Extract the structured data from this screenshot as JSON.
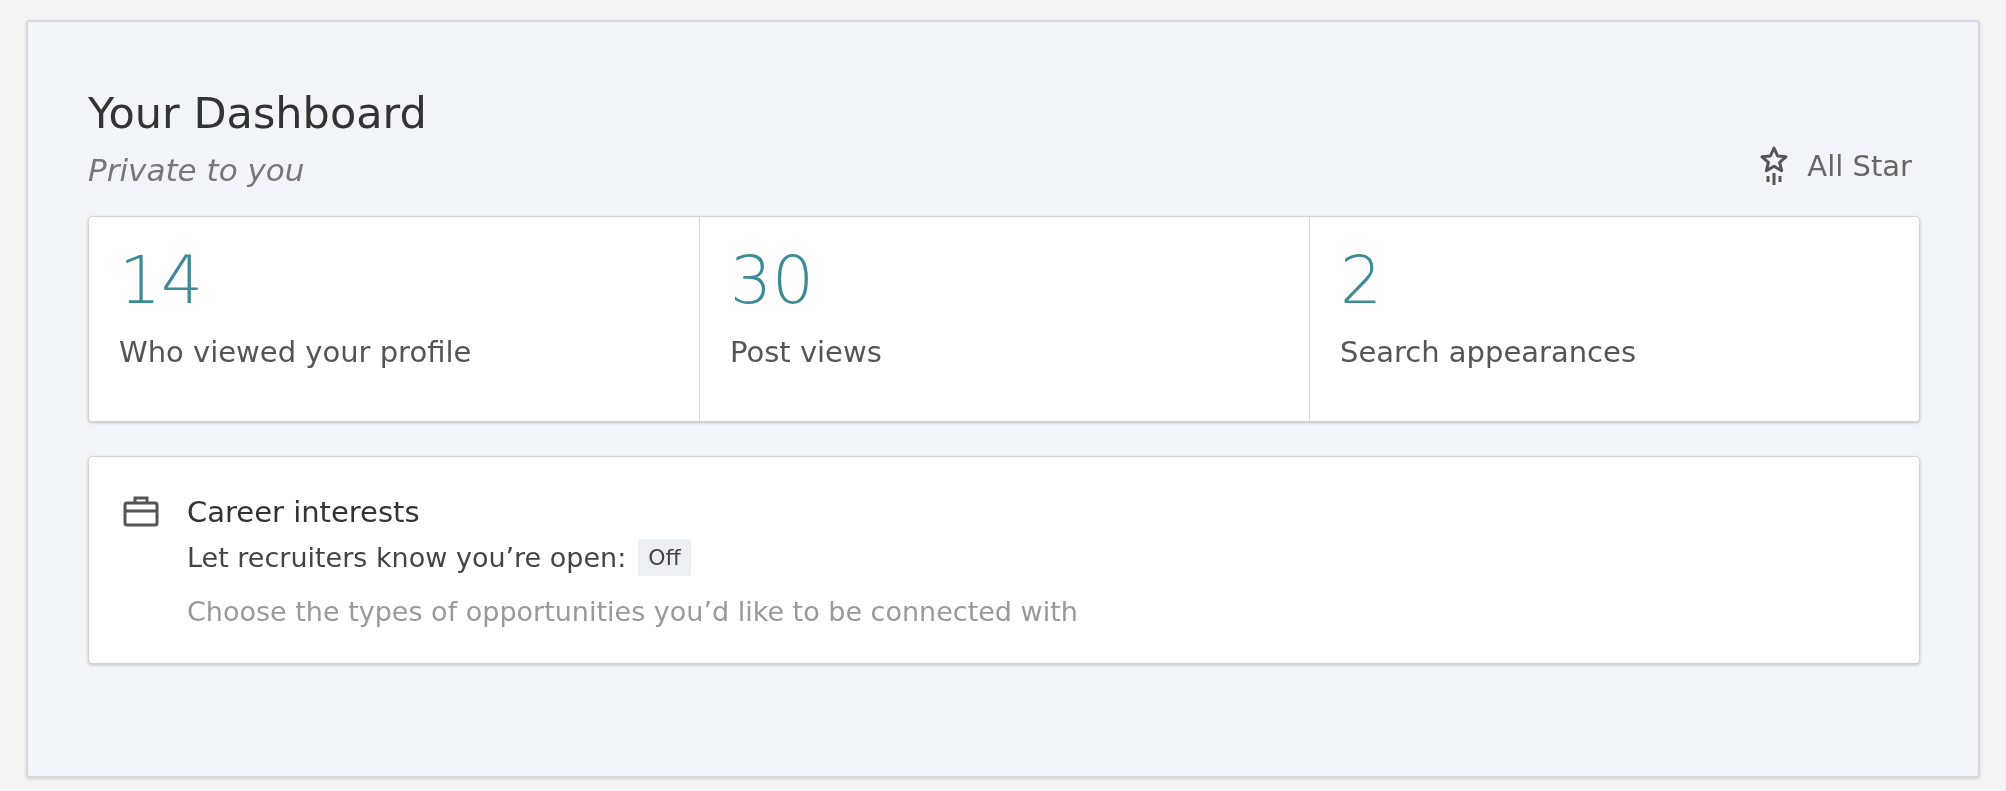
{
  "dashboard": {
    "title": "Your Dashboard",
    "subtitle": "Private to you",
    "level_badge": "All Star"
  },
  "stats": [
    {
      "value": "14",
      "label": "Who viewed your profile"
    },
    {
      "value": "30",
      "label": "Post views"
    },
    {
      "value": "2",
      "label": "Search appearances"
    }
  ],
  "career_interests": {
    "title": "Career interests",
    "open_label": "Let recruiters know you’re open:",
    "open_status": "Off",
    "hint": "Choose the types of opportunities you’d like to be connected with"
  }
}
